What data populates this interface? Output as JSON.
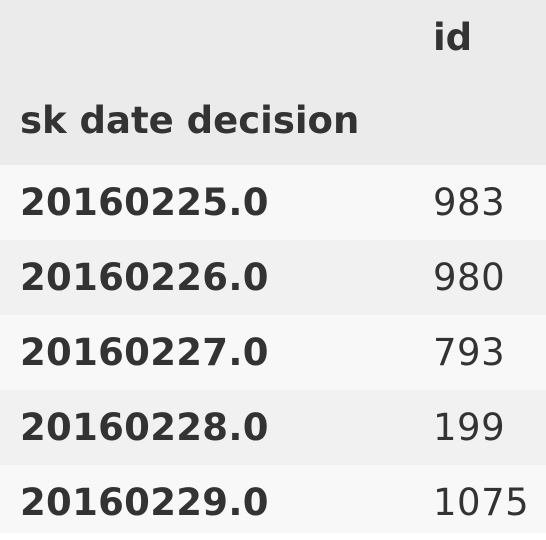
{
  "table": {
    "header": {
      "columns_label": "id",
      "index_label": "sk date decision"
    },
    "rows": [
      {
        "index": "20160225.0",
        "id": "983"
      },
      {
        "index": "20160226.0",
        "id": "980"
      },
      {
        "index": "20160227.0",
        "id": "793"
      },
      {
        "index": "20160228.0",
        "id": "199"
      },
      {
        "index": "20160229.0",
        "id": "1075"
      }
    ]
  }
}
